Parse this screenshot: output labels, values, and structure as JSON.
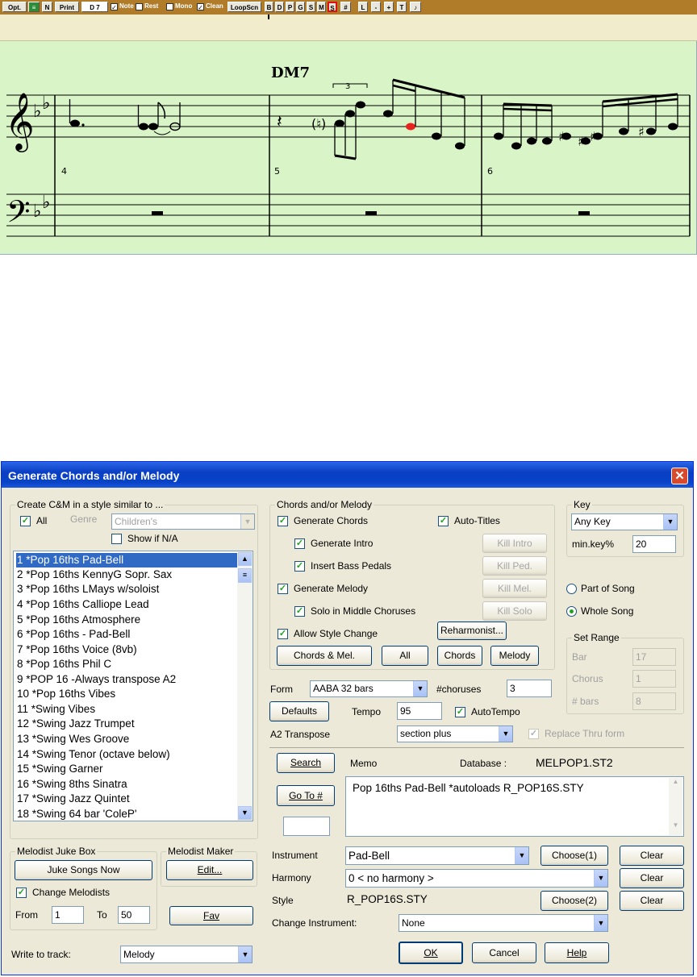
{
  "notation": {
    "toolbar": {
      "opt": "Opt.",
      "n": "N",
      "print": "Print",
      "chord_box": "D 7",
      "note_label": "Note",
      "rest_label": "Rest",
      "mono_label": "Mono",
      "clean_label": "Clean",
      "loopscn": "LoopScn",
      "part_buttons": [
        "B",
        "D",
        "P",
        "G",
        "S",
        "M",
        "S",
        "#"
      ],
      "nav_buttons": [
        "L",
        "-",
        "+",
        "T"
      ]
    },
    "chord_symbol": "DM7",
    "bar_numbers": [
      "4",
      "5",
      "6"
    ],
    "triplet": "3",
    "colors": {
      "staff_bg": "#d9f4c6",
      "ruler_bg": "#f1eccb",
      "highlight_note": "#e8231f"
    }
  },
  "dialog": {
    "title": "Generate Chords and/or Melody",
    "create_group": {
      "label": "Create C&M in a style similar to ...",
      "all_label": "All",
      "all_checked": true,
      "genre_label": "Genre",
      "genre_value": "Children's",
      "show_na_label": "Show if N/A",
      "show_na_checked": false
    },
    "style_list": [
      "1 *Pop 16ths Pad-Bell",
      "2 *Pop 16ths KennyG Sopr. Sax",
      "3 *Pop 16ths LMays w/soloist",
      "4 *Pop 16ths Calliope Lead",
      "5 *Pop 16ths Atmosphere",
      "6 *Pop 16ths - Pad-Bell",
      "7 *Pop 16ths Voice (8vb)",
      "8 *Pop 16ths Phil C",
      "9 *POP 16 -Always transpose A2",
      "10 *Pop 16ths Vibes",
      "11 *Swing Vibes",
      "12 *Swing Jazz Trumpet",
      "13 *Swing Wes Groove",
      "14 *Swing Tenor (octave below)",
      "15 *Swing Garner",
      "16 *Swing 8ths Sinatra",
      "17 *Swing Jazz Quintet",
      "18 *Swing 64 bar 'ColeP'"
    ],
    "juke_group": {
      "label": "Melodist Juke Box",
      "juke_button": "Juke Songs Now",
      "change_melodists_label": "Change Melodists",
      "change_melodists_checked": true,
      "from_label": "From",
      "from_value": "1",
      "to_label": "To",
      "to_value": "50"
    },
    "maker_group": {
      "label": "Melodist Maker",
      "edit_button": "Edit...",
      "fav_button": "Fav"
    },
    "write_to_track": {
      "label": "Write to track:",
      "value": "Melody"
    },
    "chords_group": {
      "label": "Chords and/or Melody",
      "generate_chords": "Generate Chords",
      "generate_intro": "Generate Intro",
      "insert_bass": "Insert Bass Pedals",
      "generate_melody": "Generate Melody",
      "solo_middle": "Solo in Middle Choruses",
      "allow_style_change": "Allow Style Change",
      "auto_titles": "Auto-Titles",
      "kill_intro": "Kill Intro",
      "kill_ped": "Kill Ped.",
      "kill_mel": "Kill Mel.",
      "kill_solo": "Kill Solo",
      "reharmonist": "Reharmonist...",
      "chords_mel_button": "Chords & Mel.",
      "all_button": "All",
      "chords_button": "Chords",
      "melody_button": "Melody"
    },
    "key_group": {
      "label": "Key",
      "key_value": "Any Key",
      "minkey_label": "min.key%",
      "minkey_value": "20"
    },
    "part_of_song": "Part of Song",
    "whole_song": "Whole Song",
    "range_group": {
      "label": "Set Range",
      "bar_label": "Bar",
      "bar_value": "17",
      "chorus_label": "Chorus",
      "chorus_value": "1",
      "bars_label": "# bars",
      "bars_value": "8"
    },
    "form": {
      "label": "Form",
      "value": "AABA 32 bars"
    },
    "choruses": {
      "label": "#choruses",
      "value": "3"
    },
    "defaults_button": "Defaults",
    "tempo": {
      "label": "Tempo",
      "value": "95"
    },
    "autotempo_label": "AutoTempo",
    "a2_transpose": {
      "label": "A2 Transpose",
      "value": "section plus"
    },
    "replace_thru_form": "Replace Thru form",
    "search_button": "Search",
    "goto_button": "Go To #",
    "goto_value": "",
    "memo_label": "Memo",
    "database_label": "Database :",
    "database_value": "MELPOP1.ST2",
    "memo_text": "Pop 16ths Pad-Bell   *autoloads R_POP16S.STY",
    "instrument": {
      "label": "Instrument",
      "value": "Pad-Bell",
      "choose": "Choose(1)",
      "clear": "Clear"
    },
    "harmony": {
      "label": "Harmony",
      "value": "0 < no harmony >",
      "clear": "Clear"
    },
    "style": {
      "label": "Style",
      "value": "R_POP16S.STY",
      "choose": "Choose(2)",
      "clear": "Clear"
    },
    "change_instrument": {
      "label": "Change Instrument:",
      "value": "None"
    },
    "ok_button": "OK",
    "cancel_button": "Cancel",
    "help_button": "Help",
    "colors": {
      "titlebar": "#0a3fc4",
      "selection": "#316ac5",
      "dialog_bg": "#ece9d8"
    }
  }
}
